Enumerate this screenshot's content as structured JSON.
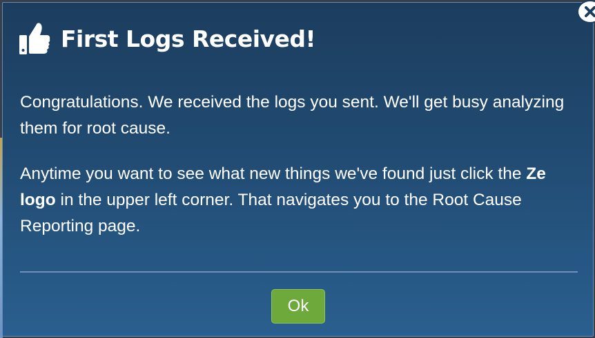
{
  "dialog": {
    "title": "First Logs Received!",
    "paragraph1": "Congratulations. We received the logs you sent. We'll get busy analyzing them for root cause.",
    "paragraph2_before": "Anytime you want to see what new things we've found just click the ",
    "paragraph2_bold": "Ze logo",
    "paragraph2_after": " in the upper left corner. That navigates you to the Root Cause Reporting page.",
    "ok_label": "Ok"
  },
  "icons": {
    "header": "thumbs-up-icon",
    "close": "close-icon"
  },
  "colors": {
    "modal_top": "#1c3d5e",
    "modal_bottom": "#2a5f8f",
    "ok_button": "#6ea93b",
    "divider": "#6f93b8",
    "text": "#ffffff"
  }
}
